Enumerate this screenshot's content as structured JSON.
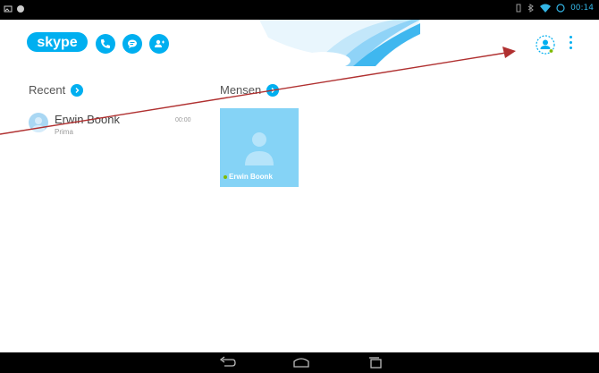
{
  "status_bar": {
    "time": "00:14"
  },
  "header": {
    "logo_text": "skype",
    "icons": [
      "call-icon",
      "chat-icon",
      "add-contact-icon",
      "profile-icon",
      "overflow-menu-icon"
    ]
  },
  "recent": {
    "title": "Recent",
    "items": [
      {
        "name": "Erwin Boonk",
        "mood": "Prima",
        "time": "00:00"
      }
    ]
  },
  "people": {
    "title": "Mensen",
    "items": [
      {
        "name": "Erwin Boonk",
        "status": "online"
      }
    ]
  },
  "colors": {
    "accent": "#00aff0",
    "tile": "#85d3f6",
    "online": "#7fba00",
    "annotation_arrow": "#b03030"
  },
  "nav_bar": {
    "icons": [
      "back-icon",
      "home-icon",
      "recent-apps-icon"
    ]
  }
}
